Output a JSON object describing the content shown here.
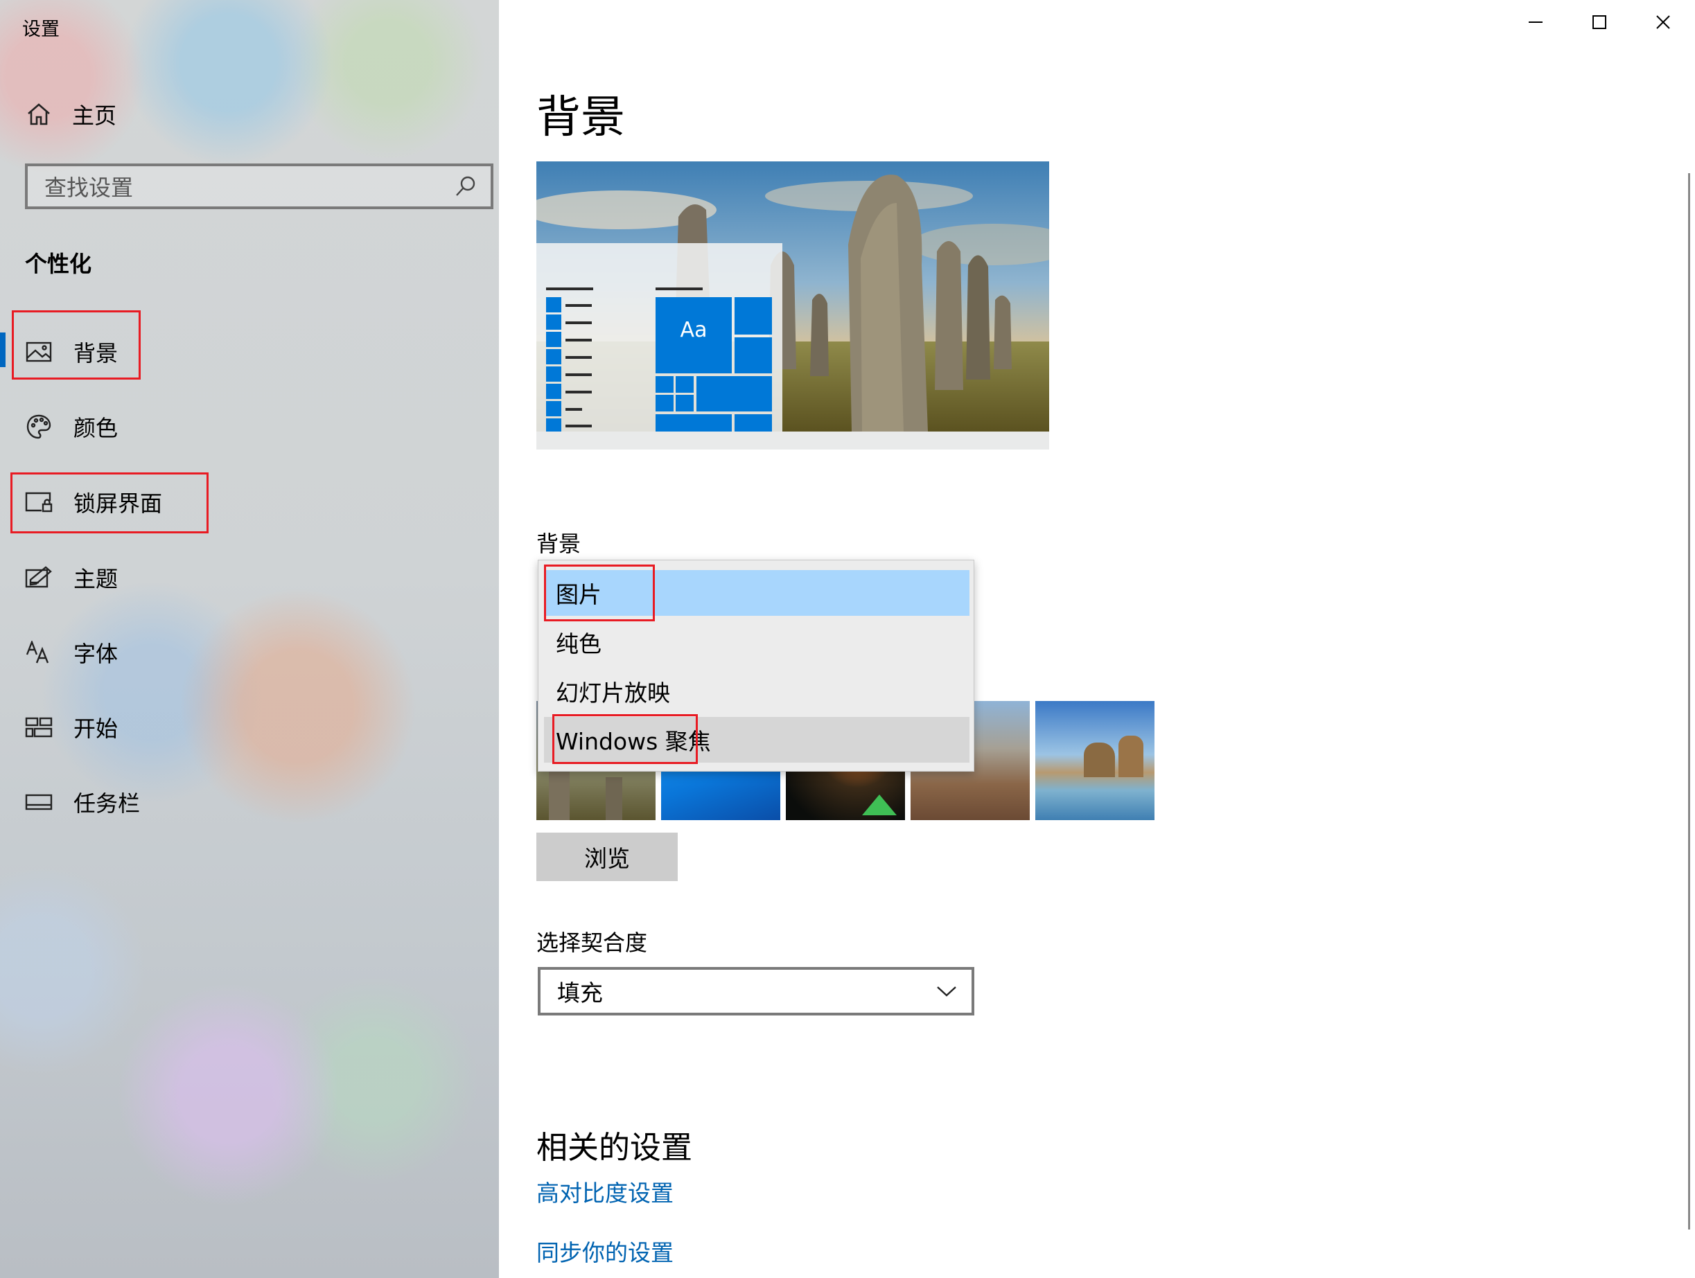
{
  "window": {
    "title": "设置",
    "controls": {
      "minimize": "minimize-icon",
      "maximize": "maximize-icon",
      "close": "close-icon"
    }
  },
  "sidebar": {
    "home_label": "主页",
    "search_placeholder": "查找设置",
    "section_title": "个性化",
    "items": [
      {
        "label": "背景",
        "icon": "picture-icon",
        "selected": true
      },
      {
        "label": "颜色",
        "icon": "palette-icon"
      },
      {
        "label": "锁屏界面",
        "icon": "lock-screen-icon"
      },
      {
        "label": "主题",
        "icon": "theme-icon"
      },
      {
        "label": "字体",
        "icon": "font-icon"
      },
      {
        "label": "开始",
        "icon": "start-icon"
      },
      {
        "label": "任务栏",
        "icon": "taskbar-icon"
      }
    ]
  },
  "main": {
    "page_title": "背景",
    "preview": {
      "tile_text": "Aa"
    },
    "background_label": "背景",
    "background_options": [
      {
        "label": "图片",
        "selected": true
      },
      {
        "label": "纯色"
      },
      {
        "label": "幻灯片放映"
      },
      {
        "label": "Windows 聚焦",
        "hovered": true
      }
    ],
    "browse_label": "浏览",
    "fit_label": "选择契合度",
    "fit_value": "填充",
    "related_title": "相关的设置",
    "links": [
      "高对比度设置",
      "同步你的设置"
    ]
  },
  "colors": {
    "accent": "#0078d7",
    "selection": "#a8d6fd",
    "link": "#0063b1",
    "annotation": "#e81b23"
  }
}
